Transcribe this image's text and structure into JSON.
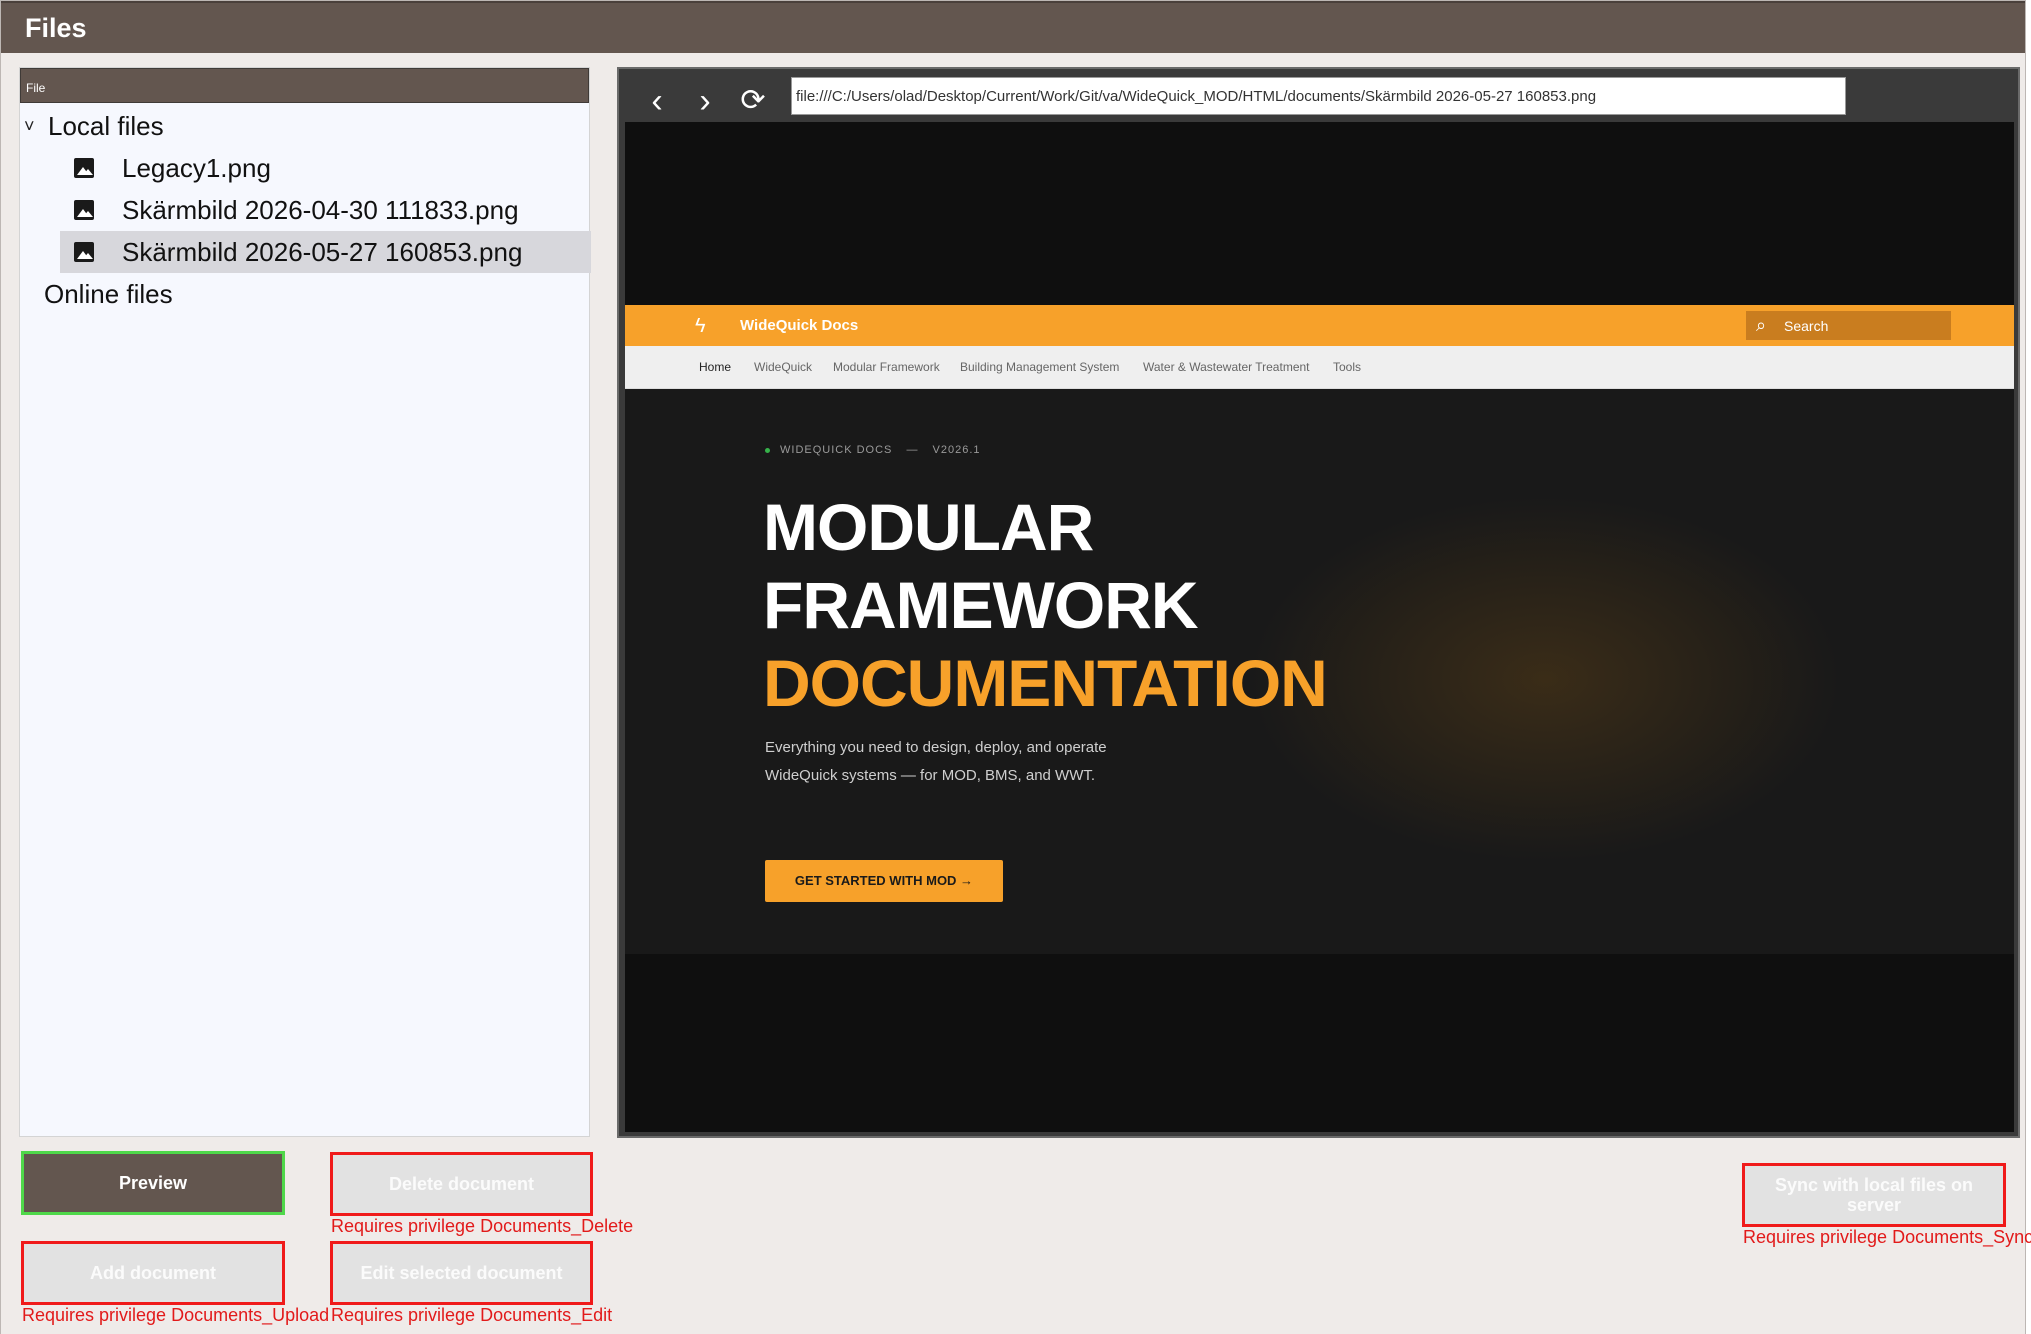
{
  "window": {
    "title": "Files"
  },
  "tree": {
    "header": "File",
    "local_label": "Local files",
    "online_label": "Online files",
    "files": [
      {
        "name": "Legacy1.png"
      },
      {
        "name": "Skärmbild 2026-04-30 111833.png"
      },
      {
        "name": "Skärmbild 2026-05-27 160853.png"
      }
    ],
    "selected_index": 2
  },
  "browser": {
    "url": "file:///C:/Users/olad/Desktop/Current/Work/Git/va/WideQuick_MOD/HTML/documents/Skärmbild 2026-05-27 160853.png",
    "site": {
      "brand": "WideQuick Docs",
      "search": "Search",
      "nav": [
        "Home",
        "WideQuick",
        "Modular Framework",
        "Building Management System",
        "Water & Wastewater Treatment",
        "Tools"
      ],
      "kicker": "WIDEQUICK DOCS",
      "kicker_sep": "—",
      "version": "V2026.1",
      "headline_1": "MODULAR",
      "headline_2": "FRAMEWORK",
      "headline_3": "DOCUMENTATION",
      "description": "Everything you need to design, deploy, and operate WideQuick systems — for MOD, BMS, and WWT.",
      "cta": "GET STARTED WITH MOD →",
      "accent": "#f7a12a"
    }
  },
  "buttons": {
    "preview": "Preview",
    "delete": "Delete document",
    "add": "Add document",
    "edit": "Edit selected document",
    "sync": "Sync with local files on server"
  },
  "requirements": {
    "delete": "Requires privilege Documents_Delete",
    "add": "Requires privilege Documents_Upload",
    "edit": "Requires privilege Documents_Edit",
    "sync": "Requires privilege Documents_Sync"
  },
  "colors": {
    "titlebar": "#63564f",
    "primary_border": "#4fd84a",
    "disabled_border": "#f01a1a",
    "requirement_text": "#e21a1a"
  }
}
